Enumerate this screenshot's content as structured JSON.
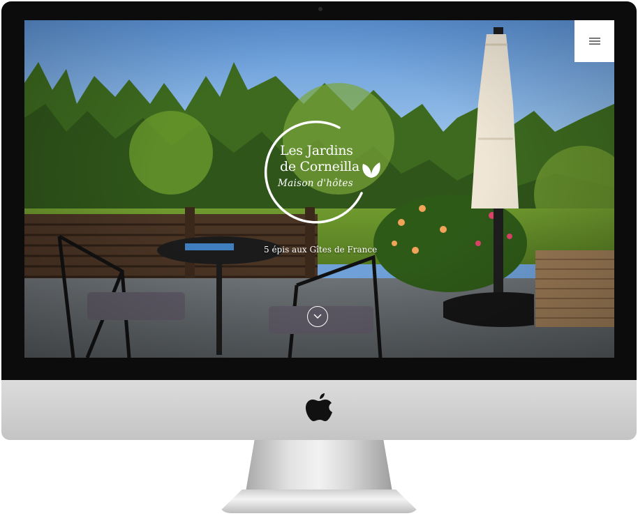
{
  "site": {
    "logo": {
      "title_line1": "Les Jardins",
      "title_line2": "de Corneilla",
      "subtitle": "Maison d'hôtes"
    },
    "tagline": "5 épis aux Gîtes de France",
    "menu_icon": "hamburger-icon",
    "scroll_icon": "chevron-down-icon"
  },
  "colors": {
    "overlay_text": "#ffffff",
    "menu_bg": "#ffffff",
    "bezel": "#0c0c0c",
    "chassis": "#d0d0d0"
  }
}
